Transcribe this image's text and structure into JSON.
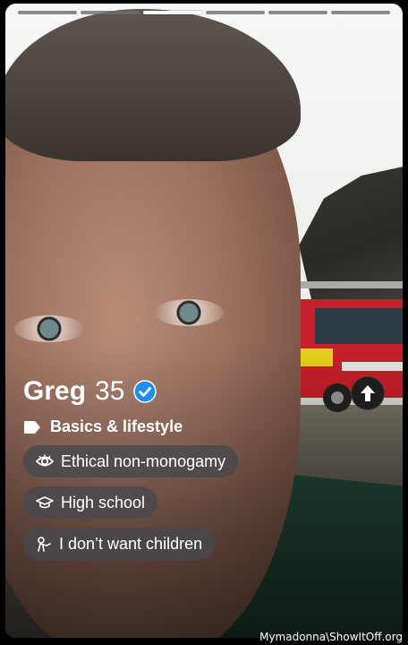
{
  "progress": {
    "segments": 6,
    "active_index": 2
  },
  "profile": {
    "name": "Greg",
    "age": "35",
    "verified": true
  },
  "section_title": "Basics & lifestyle",
  "chips": [
    {
      "icon": "eye-icon",
      "label": "Ethical non-monogamy"
    },
    {
      "icon": "graduation-cap-icon",
      "label": "High school"
    },
    {
      "icon": "baby-icon",
      "label": "I don’t want children"
    }
  ],
  "watermark": "Mymadonna\\ShowItOff.org",
  "colors": {
    "verified_blue": "#1f8cf0",
    "chip_bg": "#46484e"
  }
}
